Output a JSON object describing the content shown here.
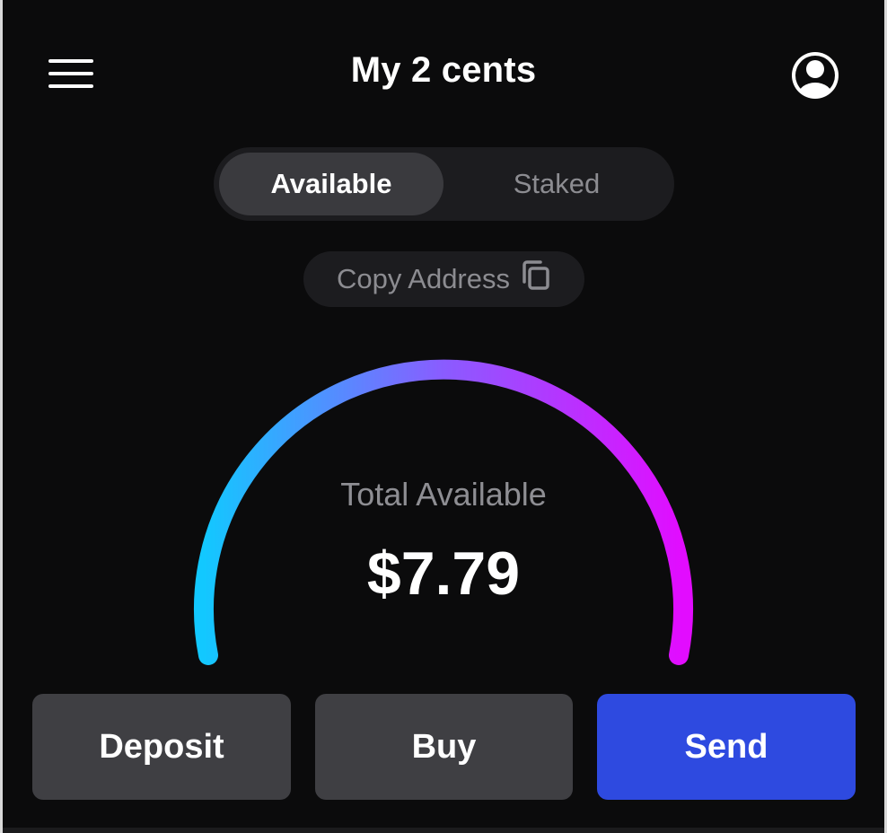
{
  "header": {
    "title": "My 2 cents",
    "menu_icon": "hamburger-menu-icon",
    "profile_icon": "user-avatar-icon"
  },
  "tabs": [
    {
      "label": "Available",
      "selected": true
    },
    {
      "label": "Staked",
      "selected": false
    }
  ],
  "copy_address": {
    "label": "Copy Address",
    "icon": "copy-icon"
  },
  "balance": {
    "label": "Total Available",
    "value": "$7.79"
  },
  "gauge": {
    "gradient_start_color": "#12c8ff",
    "gradient_mid_color": "#8a5cff",
    "gradient_end_color": "#e20cff"
  },
  "actions": {
    "deposit_label": "Deposit",
    "buy_label": "Buy",
    "send_label": "Send",
    "send_color": "#2e4ae0"
  }
}
